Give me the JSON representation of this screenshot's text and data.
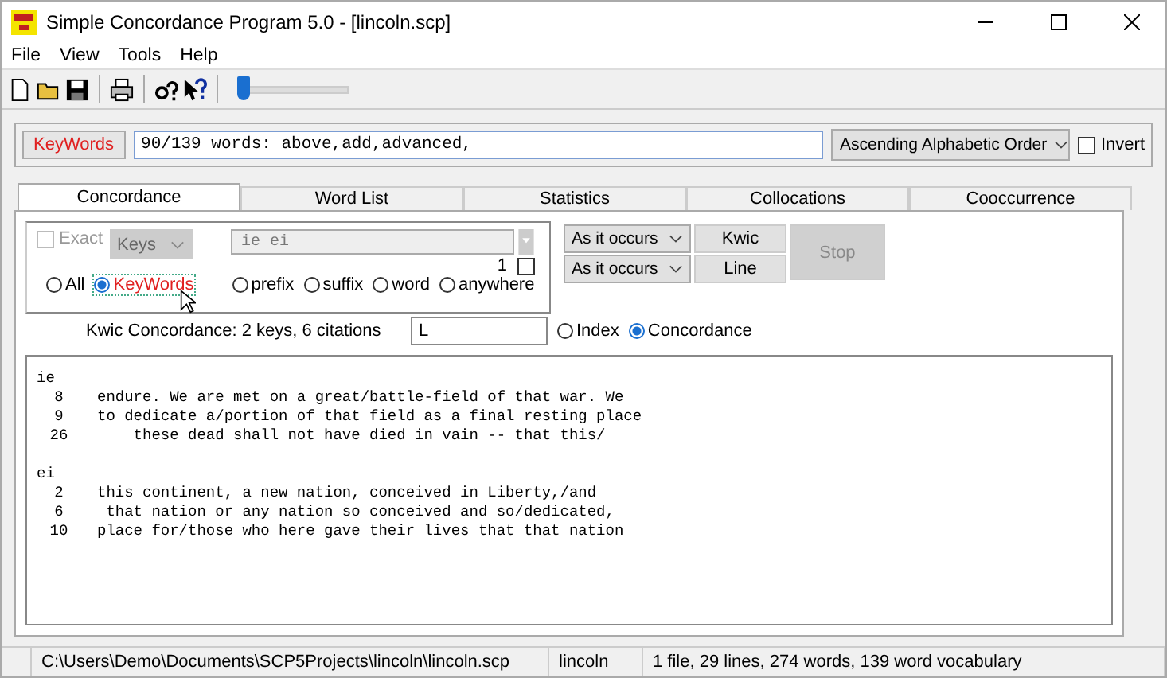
{
  "window": {
    "title": "Simple Concordance Program 5.0 - [lincoln.scp]"
  },
  "menu": [
    "File",
    "View",
    "Tools",
    "Help"
  ],
  "toolbar": {
    "zoom_slider": {
      "level": 0.0
    }
  },
  "keywords_bar": {
    "keywords_button": "KeyWords",
    "word_list": "90/139 words: above,add,advanced,",
    "sort_order": "Ascending Alphabetic Order",
    "invert": {
      "label": "Invert",
      "checked": false
    }
  },
  "tabs": [
    {
      "label": "Concordance",
      "selected": true
    },
    {
      "label": "Word List",
      "selected": false
    },
    {
      "label": "Statistics",
      "selected": false
    },
    {
      "label": "Collocations",
      "selected": false
    },
    {
      "label": "Cooccurrence",
      "selected": false
    }
  ],
  "search": {
    "exact": {
      "label": "Exact",
      "checked": false,
      "disabled": true
    },
    "keys_dropdown": {
      "value": "Keys",
      "disabled": true
    },
    "keys_field": "ie ei",
    "counter": "1",
    "counter_checkbox": {
      "checked": false
    },
    "scope": [
      {
        "label": "All",
        "selected": false
      },
      {
        "label": "KeyWords",
        "selected": true
      }
    ],
    "match": [
      {
        "label": "prefix",
        "selected": false
      },
      {
        "label": "suffix",
        "selected": false
      },
      {
        "label": "word",
        "selected": false
      },
      {
        "label": "anywhere",
        "selected": false
      }
    ]
  },
  "sort_dropdowns": [
    "As it occurs",
    "As it occurs"
  ],
  "buttons": [
    {
      "label": "Kwic",
      "disabled": false
    },
    {
      "label": "Line",
      "disabled": false
    },
    {
      "label": "Stop",
      "disabled": true
    }
  ],
  "summary": "Kwic Concordance:  2 keys, 6 citations",
  "line_field": "L",
  "view": [
    {
      "label": "Index",
      "selected": false
    },
    {
      "label": "Concordance",
      "selected": true
    }
  ],
  "results": [
    {
      "key": "ie",
      "lines": [
        {
          "number": "8",
          "text": "endure. We are met on a great/battle-field of that war. We"
        },
        {
          "number": "9",
          "text": "to dedicate a/portion of that field as a final resting place"
        },
        {
          "number": "26",
          "text": "    these dead shall not have died in vain -- that this/"
        }
      ]
    },
    {
      "key": "ei",
      "lines": [
        {
          "number": "2",
          "text": "this continent, a new nation, conceived in Liberty,/and"
        },
        {
          "number": "6",
          "text": " that nation or any nation so conceived and so/dedicated,"
        },
        {
          "number": "10",
          "text": "place for/those who here gave their lives that that nation"
        }
      ]
    }
  ],
  "status_bar": [
    "C:\\Users\\Demo\\Documents\\SCP5Projects\\lincoln\\lincoln.scp",
    "lincoln",
    "1 file, 29 lines, 274 words, 139 word vocabulary"
  ]
}
